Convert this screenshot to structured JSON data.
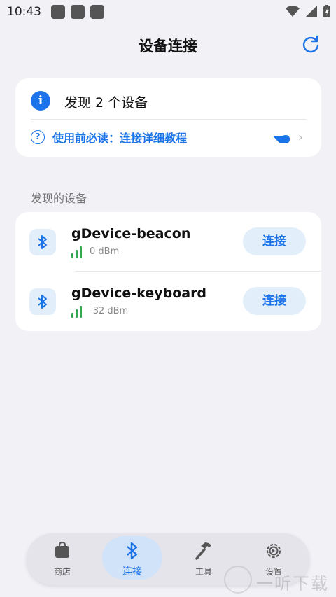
{
  "status_bar": {
    "time": "10:43"
  },
  "header": {
    "title": "设备连接"
  },
  "info_card": {
    "found_text": "发现 2 个设备",
    "tutorial_label": "使用前必读：连接详细教程"
  },
  "section": {
    "label": "发现的设备"
  },
  "devices": [
    {
      "name": "gDevice-beacon",
      "rssi": "0 dBm",
      "action": "连接"
    },
    {
      "name": "gDevice-keyboard",
      "rssi": "-32 dBm",
      "action": "连接"
    }
  ],
  "bottom_nav": {
    "items": [
      {
        "label": "商店",
        "icon": "shopping-bag-icon"
      },
      {
        "label": "连接",
        "icon": "bluetooth-icon",
        "active": true
      },
      {
        "label": "工具",
        "icon": "hammer-icon"
      },
      {
        "label": "设置",
        "icon": "settings-gear-icon"
      }
    ]
  },
  "watermark": {
    "text": "一听下载"
  },
  "colors": {
    "accent": "#1a73e8",
    "background": "#f1f1f6",
    "signal": "#34a853",
    "tile": "#e3eefb"
  }
}
